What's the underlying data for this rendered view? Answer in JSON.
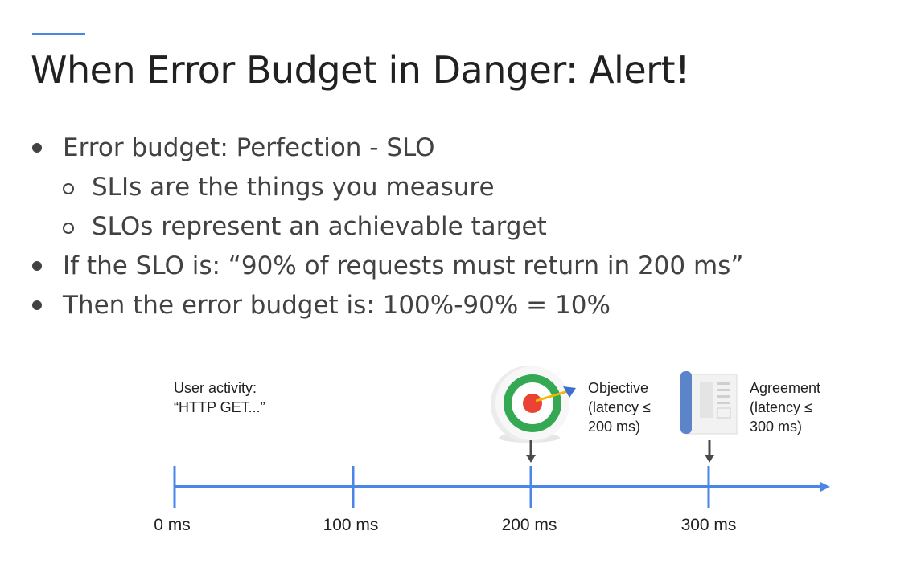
{
  "slide": {
    "title": "When Error Budget in Danger: Alert!",
    "bullets": [
      {
        "level": 1,
        "text": "Error budget: Perfection - SLO"
      },
      {
        "level": 2,
        "text": "SLIs are the things you measure"
      },
      {
        "level": 2,
        "text": "SLOs represent an achievable target"
      },
      {
        "level": 1,
        "text": "If the SLO is: “90% of requests must return in 200 ms”"
      },
      {
        "level": 1,
        "text": "Then the error budget is: 100%-90% = 10%"
      }
    ]
  },
  "diagram": {
    "user_activity": {
      "line1": "User activity:",
      "line2": "“HTTP GET...”"
    },
    "objective": {
      "line1": "Objective",
      "line2": "(latency ≤",
      "line3": "200 ms)",
      "icon": "target-icon"
    },
    "agreement": {
      "line1": "Agreement",
      "line2": "(latency ≤",
      "line3": "300 ms)",
      "icon": "document-icon"
    },
    "ticks": [
      "0 ms",
      "100 ms",
      "200 ms",
      "300 ms"
    ],
    "colors": {
      "axis": "#4a86e8",
      "arrow": "#4a4a4a",
      "target_green": "#34a853",
      "target_red": "#ea4335"
    }
  }
}
